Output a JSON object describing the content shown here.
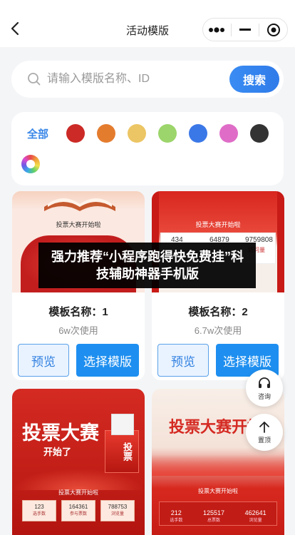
{
  "header": {
    "title": "活动模版"
  },
  "search": {
    "placeholder": "请输入模版名称、ID",
    "button_label": "搜索"
  },
  "filter": {
    "all_label": "全部",
    "colors": [
      "#cc2a26",
      "#e47c2e",
      "#ecc564",
      "#9cd56b",
      "#3b78e7",
      "#df6dc7",
      "#333333",
      "rainbow"
    ]
  },
  "cards": [
    {
      "name": "模板名称：1",
      "uses": "6w次使用",
      "preview": "预览",
      "select": "选择模版",
      "thumb_title": "投票大赛开始啦"
    },
    {
      "name": "模板名称：2",
      "uses": "6.7w次使用",
      "preview": "预览",
      "select": "选择模版",
      "thumb_title": "投票大赛开始啦",
      "stats": [
        "434",
        "64879",
        "9759808"
      ],
      "stat_label_a": "访问量"
    }
  ],
  "big_cards": [
    {
      "title": "投票大赛",
      "subtitle": "开始了",
      "box_label": "投票",
      "banner": "投票大赛开始啦",
      "stats": [
        "123",
        "164361",
        "788753"
      ],
      "stat_labels": [
        "选手数",
        "参与票数",
        "浏览量"
      ]
    },
    {
      "title": "投票大赛开始",
      "banner": "投票大赛开始啦",
      "stats": [
        "212",
        "125517",
        "462641"
      ],
      "stat_labels": [
        "选手数",
        "总票数",
        "浏览量"
      ]
    }
  ],
  "overlay": {
    "text": "强力推荐“小程序跑得快免费挂”科技辅助神器手机版"
  },
  "float": {
    "consult": "咨询",
    "top": "置顶"
  }
}
